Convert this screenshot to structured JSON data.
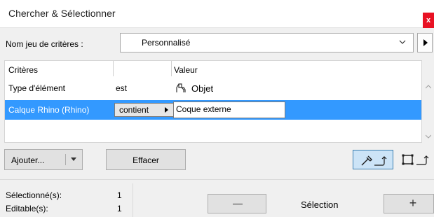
{
  "window": {
    "title": "Chercher & Sélectionner",
    "close_label": "x"
  },
  "criteria_set": {
    "label": "Nom jeu de critères :",
    "value": "Personnalisé"
  },
  "table": {
    "headers": [
      "Critères",
      "",
      "Valeur"
    ],
    "rows": [
      {
        "criterion": "Type d'élément",
        "operator": "est",
        "value": "Objet",
        "value_icon": "object-icon"
      },
      {
        "criterion": "Calque Rhino (Rhino)",
        "operator": "contient",
        "value": "Coque externe",
        "selected": true
      }
    ]
  },
  "buttons": {
    "add": "Ajouter...",
    "clear": "Effacer"
  },
  "stats": {
    "selected_label": "Sélectionné(s):",
    "selected_value": "1",
    "editable_label": "Editable(s):",
    "editable_value": "1"
  },
  "selection": {
    "label": "Sélection",
    "minus": "—",
    "plus": "+"
  },
  "colors": {
    "highlight": "#3399ff",
    "close": "#e81123"
  }
}
